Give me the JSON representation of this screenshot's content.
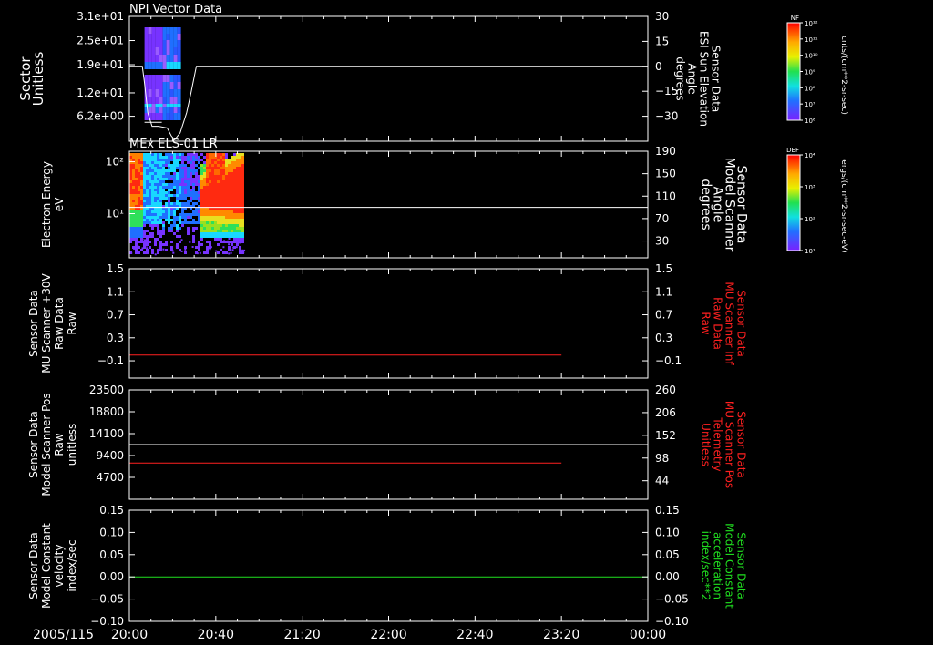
{
  "colors": {
    "bg": "#000000",
    "frame": "#ffffff",
    "text": "#ffffff",
    "red": "#ff2020",
    "green": "#20e020",
    "spec_purple": "#7733ff",
    "spec_blue": "#1f6fff",
    "spec_cyan": "#18d8ff",
    "spec_green": "#2ee05a",
    "spec_yellow": "#e8e020",
    "spec_red": "#ff2a10"
  },
  "time_axis": {
    "date_label": "2005/115",
    "ticks": [
      "20:00",
      "20:40",
      "21:20",
      "22:00",
      "22:40",
      "23:20",
      "00:00"
    ],
    "start_minutes": 0,
    "end_minutes": 240
  },
  "colorbars": [
    {
      "label": "NF",
      "unit": "cnts/(cm**2-sr-sec)",
      "tick_labels": [
        "10¹²",
        "10¹¹",
        "10¹⁰",
        "10⁹",
        "10⁸",
        "10⁷",
        "10⁶"
      ],
      "tick_values": [
        12,
        11,
        10,
        9,
        8,
        7,
        6
      ],
      "range": [
        6,
        12
      ]
    },
    {
      "label": "DEF",
      "unit": "ergs/(cm**2-sr-sec-eV)",
      "tick_labels": [
        "10⁴",
        "10³",
        "10²",
        "10¹"
      ],
      "tick_values": [
        4,
        3,
        2,
        1
      ],
      "range": [
        1,
        4
      ]
    }
  ],
  "chart_data": [
    {
      "type": "heatmap",
      "title": "NPI Vector Data",
      "ylabel": "Sector\nUnitless",
      "yticks": [
        "3.1e+01",
        "2.5e+01",
        "1.9e+01",
        "1.2e+01",
        "6.2e+00"
      ],
      "ytick_values": [
        31,
        25,
        19,
        12,
        6.2
      ],
      "ylim": [
        0,
        31
      ],
      "y2label": "Sensor Data\nESI Sun Elevation\nAngle\ndegrees",
      "y2ticks": [
        "30",
        "15",
        "0",
        "−15",
        "−30"
      ],
      "y2tick_values": [
        30,
        15,
        0,
        -15,
        -30
      ],
      "y2lim": [
        -45,
        30
      ],
      "data_span_minutes": [
        7,
        22.5
      ],
      "series": [
        {
          "label": "Sun Elevation",
          "color": "white",
          "axis": "y2",
          "x": [
            0,
            6,
            7,
            8.5,
            10.5,
            13.5,
            17.5,
            19.5,
            21,
            23.5,
            26.5,
            28.5,
            31,
            240
          ],
          "y": [
            0,
            0,
            -10,
            -28,
            -36,
            -36,
            -37,
            -42,
            -44,
            -40,
            -28,
            -16,
            0,
            0
          ]
        },
        {
          "label": "Sector plateau",
          "color": "white",
          "axis": "y",
          "x": [
            7,
            15
          ],
          "y": [
            4.7,
            4.7
          ]
        }
      ]
    },
    {
      "type": "heatmap",
      "title": "MEx ELS-01 LR",
      "ylabel": "Electron Energy\neV",
      "yticks": [
        "10²",
        "10¹"
      ],
      "ytick_values": [
        100,
        10
      ],
      "ylim_log10": [
        0.15,
        2.2
      ],
      "y2label": "Sensor Data\nModel Scanner\nAngle\ndegrees",
      "y2ticks": [
        "190",
        "150",
        "110",
        "70",
        "30"
      ],
      "y2tick_values": [
        190,
        150,
        110,
        70,
        30
      ],
      "y2lim": [
        0,
        190
      ],
      "data_span_minutes": [
        0,
        53
      ],
      "series": [
        {
          "label": "Scanner Angle",
          "color": "white",
          "axis": "y2",
          "x": [
            0,
            240
          ],
          "y": [
            90,
            90
          ]
        }
      ]
    },
    {
      "type": "line",
      "title": "",
      "ylabel": "Sensor Data\nMU Scanner +30V\nRaw Data\nRaw",
      "yticks": [
        "1.5",
        "1.1",
        "0.7",
        "0.3",
        "−0.1"
      ],
      "ytick_values": [
        1.5,
        1.1,
        0.7,
        0.3,
        -0.1
      ],
      "ylim": [
        -0.4,
        1.5
      ],
      "y2label": "Sensor Data\nMU Scanner Inf\nRaw Data\nRaw",
      "y2ticks": [
        "1.5",
        "1.1",
        "0.7",
        "0.3",
        "−0.1"
      ],
      "y2tick_values": [
        1.5,
        1.1,
        0.7,
        0.3,
        -0.1
      ],
      "y2lim": [
        -0.4,
        1.5
      ],
      "series": [
        {
          "label": "MU Scanner Inf",
          "color": "red",
          "axis": "y2",
          "x": [
            0,
            200
          ],
          "y": [
            0.0,
            0.0
          ]
        }
      ]
    },
    {
      "type": "line",
      "title": "",
      "ylabel": "Sensor Data\nModel Scanner Pos\nRaw\nunitless",
      "yticks": [
        "23500",
        "18800",
        "14100",
        "9400",
        "4700"
      ],
      "ytick_values": [
        23500,
        18800,
        14100,
        9400,
        4700
      ],
      "ylim": [
        0,
        23500
      ],
      "y2label": "Sensor Data\nMU Scanner Pos\nTelemetry\nUnitless",
      "y2ticks": [
        "260",
        "206",
        "152",
        "98",
        "44"
      ],
      "y2tick_values": [
        260,
        206,
        152,
        98,
        44
      ],
      "y2lim": [
        0,
        260
      ],
      "series": [
        {
          "label": "Model Scanner Pos",
          "color": "white",
          "axis": "y",
          "x": [
            0,
            240
          ],
          "y": [
            11750,
            11750
          ]
        },
        {
          "label": "MU Scanner Pos",
          "color": "red",
          "axis": "y2",
          "x": [
            0,
            200
          ],
          "y": [
            86,
            86
          ]
        }
      ]
    },
    {
      "type": "line",
      "title": "",
      "ylabel": "Sensor Data\nModel Constant\nvelocity\nindex/sec",
      "yticks": [
        "0.15",
        "0.10",
        "0.05",
        "0.00",
        "−0.05",
        "−0.10"
      ],
      "ytick_values": [
        0.15,
        0.1,
        0.05,
        0.0,
        -0.05,
        -0.1
      ],
      "ylim": [
        -0.1,
        0.15
      ],
      "y2label": "Sensor Data\nModel Constant\nacceleration\nindex/sec**2",
      "y2ticks": [
        "0.15",
        "0.10",
        "0.05",
        "0.00",
        "−0.05",
        "−0.10"
      ],
      "y2tick_values": [
        0.15,
        0.1,
        0.05,
        0.0,
        -0.05,
        -0.1
      ],
      "y2lim": [
        -0.1,
        0.15
      ],
      "series": [
        {
          "label": "Model Constant",
          "color": "green",
          "axis": "y",
          "x": [
            0,
            240
          ],
          "y": [
            0.0,
            0.0
          ]
        }
      ]
    }
  ]
}
